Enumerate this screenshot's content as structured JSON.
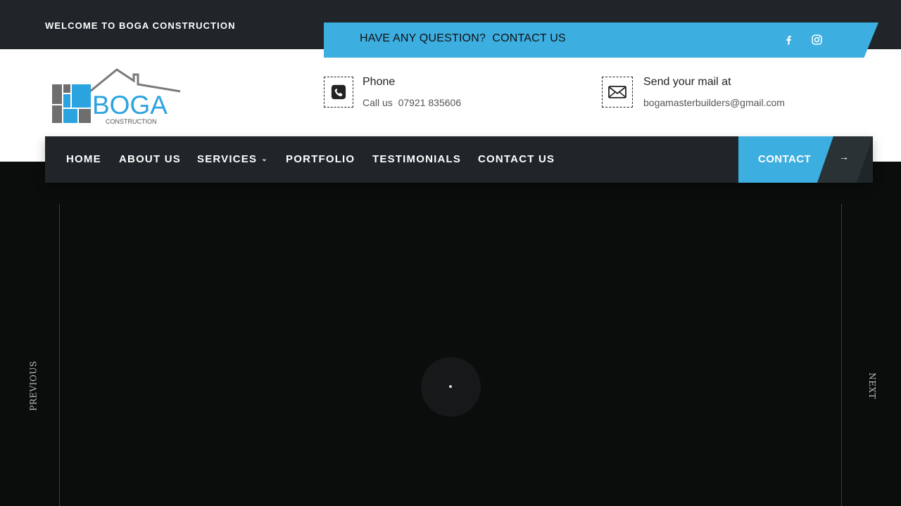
{
  "topbar": {
    "welcome": "WELCOME TO BOGA CONSTRUCTION"
  },
  "banner": {
    "question": "HAVE ANY QUESTION?  CONTACT US",
    "social": [
      {
        "icon": "facebook-icon"
      },
      {
        "icon": "instagram-icon"
      }
    ],
    "color": "#3daee0"
  },
  "logo": {
    "name": "BOGA",
    "tagline": "CONSTRUCTION"
  },
  "phone": {
    "title": "Phone",
    "sub": "Call us  07921 835606",
    "icon": "phone-icon"
  },
  "mail": {
    "title": "Send your mail at",
    "sub": "bogamasterbuilders@gmail.com",
    "icon": "mail-icon"
  },
  "nav": {
    "items": [
      "HOME",
      "ABOUT US",
      "SERVICES",
      "PORTFOLIO",
      "TESTIMONIALS",
      "CONTACT US"
    ],
    "contact_button": "CONTACT",
    "arrow": "→"
  },
  "slider": {
    "previous": "PREVIOUS",
    "next": "NEXT"
  }
}
